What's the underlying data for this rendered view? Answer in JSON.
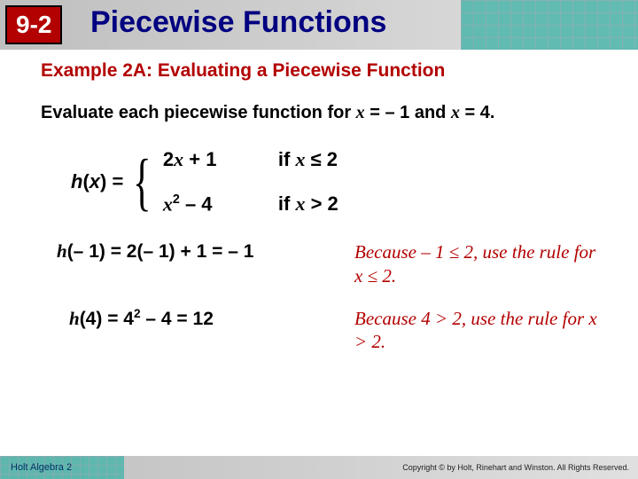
{
  "header": {
    "chapter": "9-2",
    "title": "Piecewise Functions"
  },
  "example_title": "Example 2A: Evaluating a Piecewise Function",
  "prompt_plain": "Evaluate each piecewise function for x = – 1 and x = 4.",
  "func_label": "h(x) = ",
  "piece1": {
    "expr": "2x + 1",
    "cond": "if x ≤ 2"
  },
  "piece2": {
    "expr_pre": "x",
    "expr_sup": "2",
    "expr_post": " – 4",
    "cond": "if x > 2"
  },
  "calc1": {
    "text": "h(– 1) = 2(– 1) + 1 = – 1",
    "explain": "Because – 1 ≤ 2, use the rule for x ≤ 2."
  },
  "calc2": {
    "pre": "h(4) = 4",
    "sup": "2",
    "post": " – 4 = 12",
    "explain": "Because 4 > 2, use the rule for x > 2."
  },
  "footer": {
    "left": "Holt Algebra 2",
    "right": "Copyright © by Holt, Rinehart and Winston. All Rights Reserved."
  }
}
